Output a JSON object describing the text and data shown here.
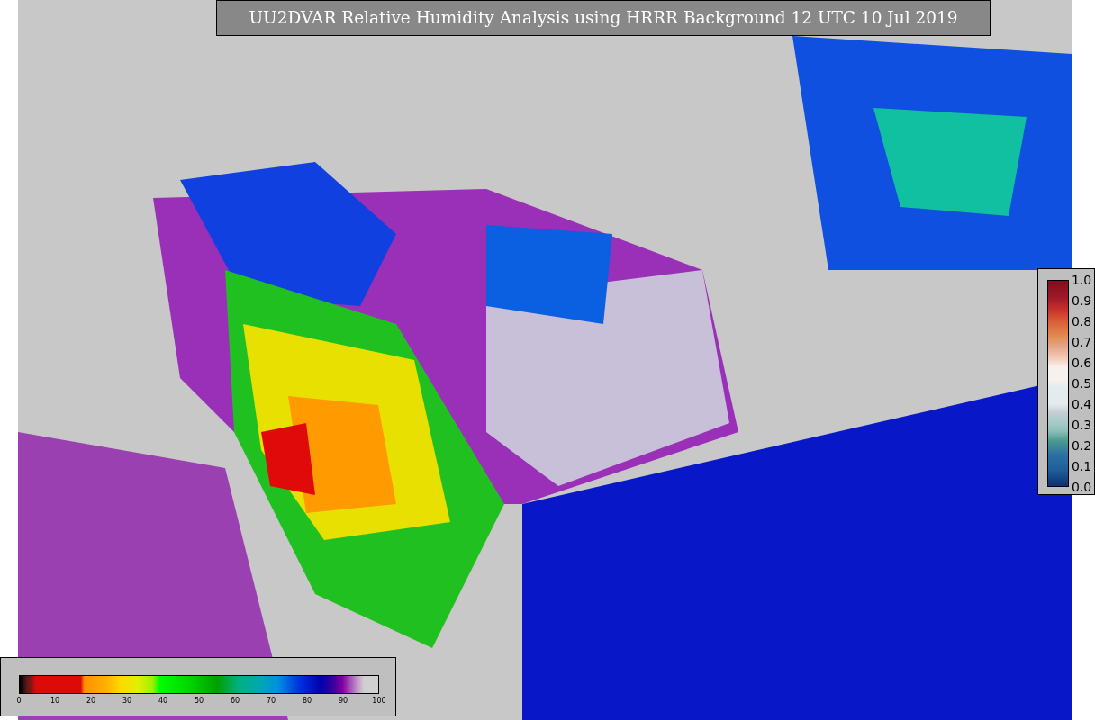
{
  "title": "UU2DVAR Relative Humidity Analysis using HRRR Background 12 UTC 10 Jul 2019",
  "vertical_colorbar": {
    "ticks": [
      "1.0",
      "0.9",
      "0.8",
      "0.7",
      "0.6",
      "0.5",
      "0.4",
      "0.3",
      "0.2",
      "0.1",
      "0.0"
    ]
  },
  "horizontal_colorbar": {
    "ticks": [
      "0",
      "10",
      "20",
      "30",
      "40",
      "50",
      "60",
      "70",
      "80",
      "90",
      "100"
    ]
  }
}
